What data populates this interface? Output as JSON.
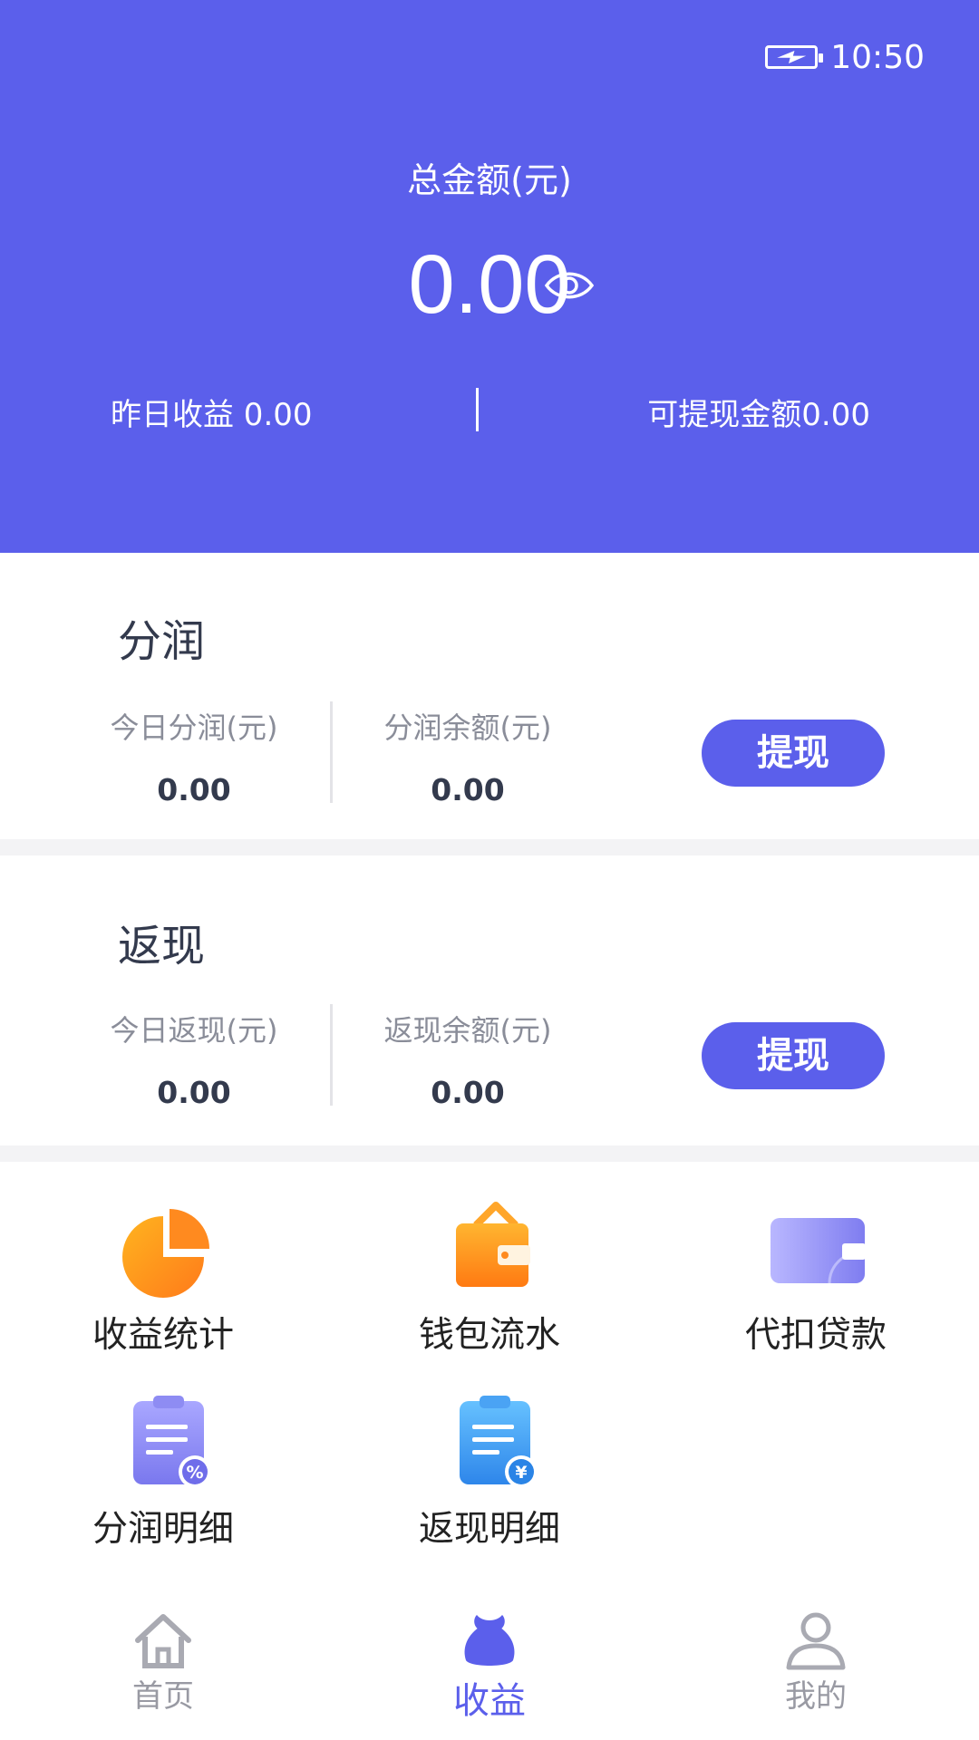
{
  "status_bar": {
    "time": "10:50"
  },
  "summary": {
    "total_label": "总金额(元)",
    "total_value": "0.00",
    "yesterday": "昨日收益 0.00",
    "withdrawable": "可提现金额0.00"
  },
  "profit_share": {
    "title": "分润",
    "today_label": "今日分润(元)",
    "today_value": "0.00",
    "balance_label": "分润余额(元)",
    "balance_value": "0.00",
    "button": "提现"
  },
  "cashback": {
    "title": "返现",
    "today_label": "今日返现(元)",
    "today_value": "0.00",
    "balance_label": "返现余额(元)",
    "balance_value": "0.00",
    "button": "提现"
  },
  "menu": [
    {
      "label": "收益统计",
      "icon": "pie-chart-icon"
    },
    {
      "label": "钱包流水",
      "icon": "wallet-icon"
    },
    {
      "label": "代扣贷款",
      "icon": "card-icon"
    },
    {
      "label": "分润明细",
      "icon": "clipboard-percent-icon",
      "badge": "%"
    },
    {
      "label": "返现明细",
      "icon": "clipboard-yen-icon",
      "badge": "¥"
    }
  ],
  "tabs": [
    {
      "label": "首页",
      "icon": "home-icon"
    },
    {
      "label": "收益",
      "icon": "money-bag-icon",
      "active": true
    },
    {
      "label": "我的",
      "icon": "user-icon"
    }
  ],
  "colors": {
    "primary": "#5b5feb",
    "orange": "#ff8a1f",
    "blue": "#3d9bf0"
  }
}
